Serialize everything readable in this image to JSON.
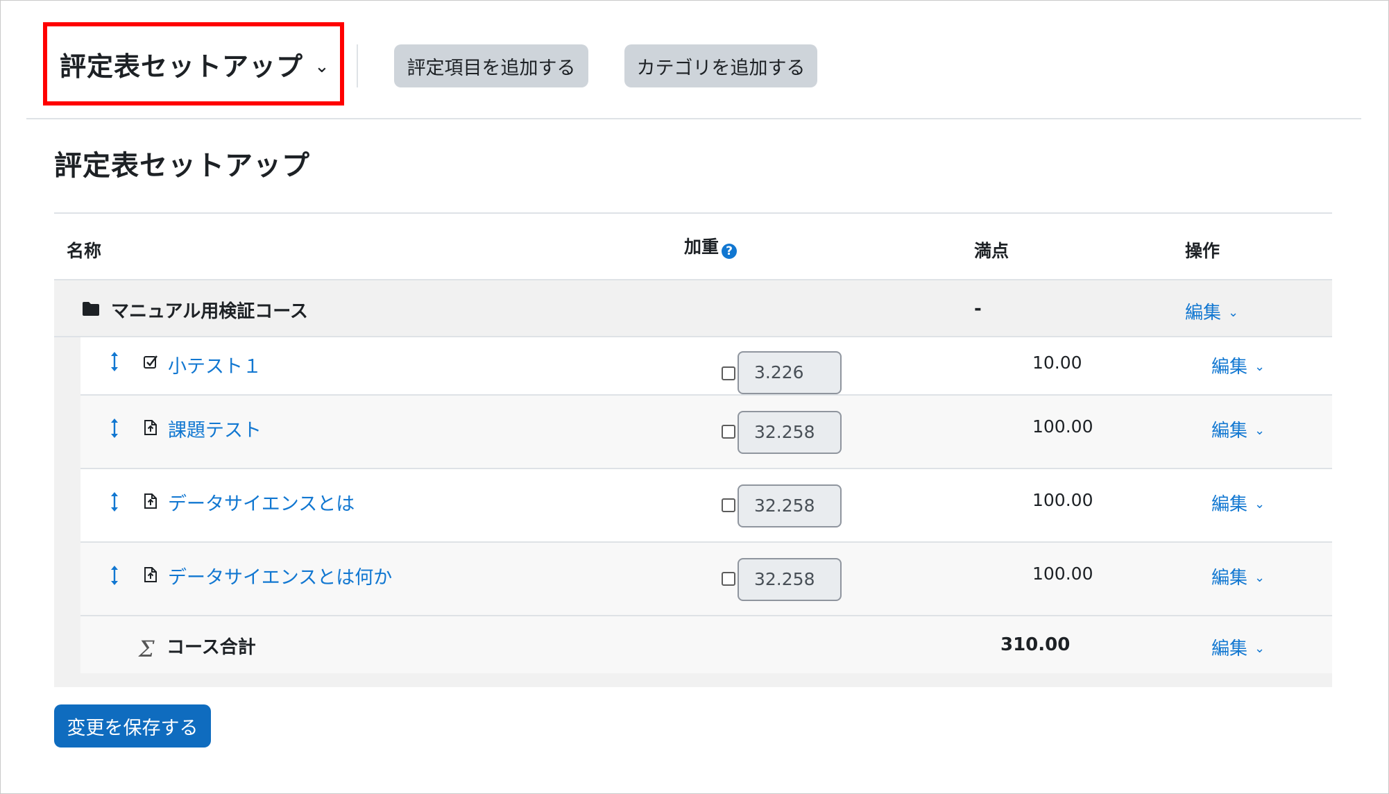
{
  "nav": {
    "selector_label": "評定表セットアップ",
    "add_item_label": "評定項目を追加する",
    "add_category_label": "カテゴリを追加する"
  },
  "page": {
    "title": "評定表セットアップ"
  },
  "table": {
    "headers": {
      "name": "名称",
      "weight": "加重",
      "max": "満点",
      "actions": "操作"
    },
    "category": {
      "name": "マニュアル用検証コース",
      "max": "-",
      "action": "編集"
    },
    "items": [
      {
        "name": "小テスト１",
        "icon": "quiz-icon",
        "weight": "3.226",
        "max": "10.00",
        "action": "編集"
      },
      {
        "name": "課題テスト",
        "icon": "assignment-icon",
        "weight": "32.258",
        "max": "100.00",
        "action": "編集"
      },
      {
        "name": "データサイエンスとは",
        "icon": "assignment-icon",
        "weight": "32.258",
        "max": "100.00",
        "action": "編集"
      },
      {
        "name": "データサイエンスとは何か",
        "icon": "assignment-icon",
        "weight": "32.258",
        "max": "100.00",
        "action": "編集"
      }
    ],
    "total": {
      "name": "コース合計",
      "max": "310.00",
      "action": "編集"
    }
  },
  "save_label": "変更を保存する",
  "colors": {
    "link": "#1177d1",
    "primary": "#0f6cbf",
    "secondary": "#ced4da",
    "highlight_border": "#ff0000"
  }
}
